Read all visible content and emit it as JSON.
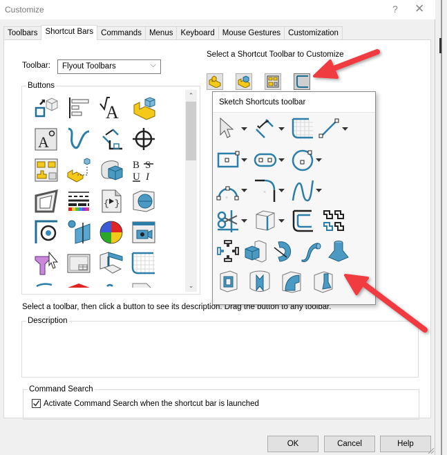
{
  "window": {
    "title": "Customize",
    "help_glyph": "?",
    "close_glyph": "✕"
  },
  "tabs": [
    {
      "label": "Toolbars",
      "active": false
    },
    {
      "label": "Shortcut Bars",
      "active": true
    },
    {
      "label": "Commands",
      "active": false
    },
    {
      "label": "Menus",
      "active": false
    },
    {
      "label": "Keyboard",
      "active": false
    },
    {
      "label": "Mouse Gestures",
      "active": false
    },
    {
      "label": "Customization",
      "active": false
    }
  ],
  "toolbar_select": {
    "label": "Toolbar:",
    "value": "Flyout Toolbars",
    "chevron": "⌵"
  },
  "buttons_group": {
    "legend": "Buttons",
    "icons": [
      "instant3d-icon",
      "align-left-icon",
      "smart-dimension-text-icon",
      "part-features-icon",
      "note-annotation-icon",
      "spline-icon",
      "dimension-xpert-icon",
      "origin-crosshair-icon",
      "layout-toolbar-icon",
      "mate-reference-icon",
      "wrap-feature-icon",
      "font-style-icon",
      "linkage-sketch-icon",
      "line-format-icon",
      "macro-run-icon",
      "section-view-icon",
      "hole-callout-icon",
      "reference-plane-icon",
      "appearance-ball-icon",
      "camera-view-icon",
      "selection-filter-icon",
      "sheet-format-icon",
      "explode-view-icon",
      "sketch-grid-icon"
    ],
    "scroll_up": "⌃",
    "scroll_down": "⌄"
  },
  "shortcut_select": {
    "label": "Select a Shortcut Toolbar to Customize",
    "buttons": [
      {
        "name": "part-shortcut",
        "selected": false
      },
      {
        "name": "assembly-shortcut",
        "selected": false
      },
      {
        "name": "drawing-shortcut",
        "selected": false
      },
      {
        "name": "sketch-shortcut",
        "selected": true
      }
    ]
  },
  "popup": {
    "title": "Sketch Shortcuts toolbar",
    "rows": [
      [
        "select-pointer-icon",
        "smart-dimension-icon",
        "sketch-grid-icon",
        "line-icon"
      ],
      [
        "rectangle-icon",
        "slot-icon",
        "circle-icon"
      ],
      [
        "arc-icon",
        "fillet-icon",
        "spline-icon"
      ],
      [
        "trim-entities-icon",
        "convert-entities-icon",
        "offset-entities-icon",
        "mirror-entities-icon"
      ],
      [
        "linear-pattern-icon",
        "extruded-boss-icon",
        "revolved-boss-icon",
        "swept-boss-icon",
        "lofted-boss-icon"
      ],
      [
        "extruded-cut-icon",
        "revolved-cut-icon",
        "swept-cut-icon",
        "lofted-cut-icon"
      ]
    ]
  },
  "hint_text": "Select a toolbar, then click a button to see its description. Drag the button to any toolbar.",
  "description": {
    "legend": "Description",
    "text": ""
  },
  "command_search": {
    "legend": "Command Search",
    "checkbox_label": "Activate Command Search when the shortcut bar is launched",
    "checked": true
  },
  "dialog_buttons": {
    "ok": "OK",
    "cancel": "Cancel",
    "help": "Help"
  },
  "colors": {
    "accent_blue": "#2a7ea8",
    "feature_yellow": "#f2c511",
    "annotation_arrow": "#f03a3f"
  }
}
